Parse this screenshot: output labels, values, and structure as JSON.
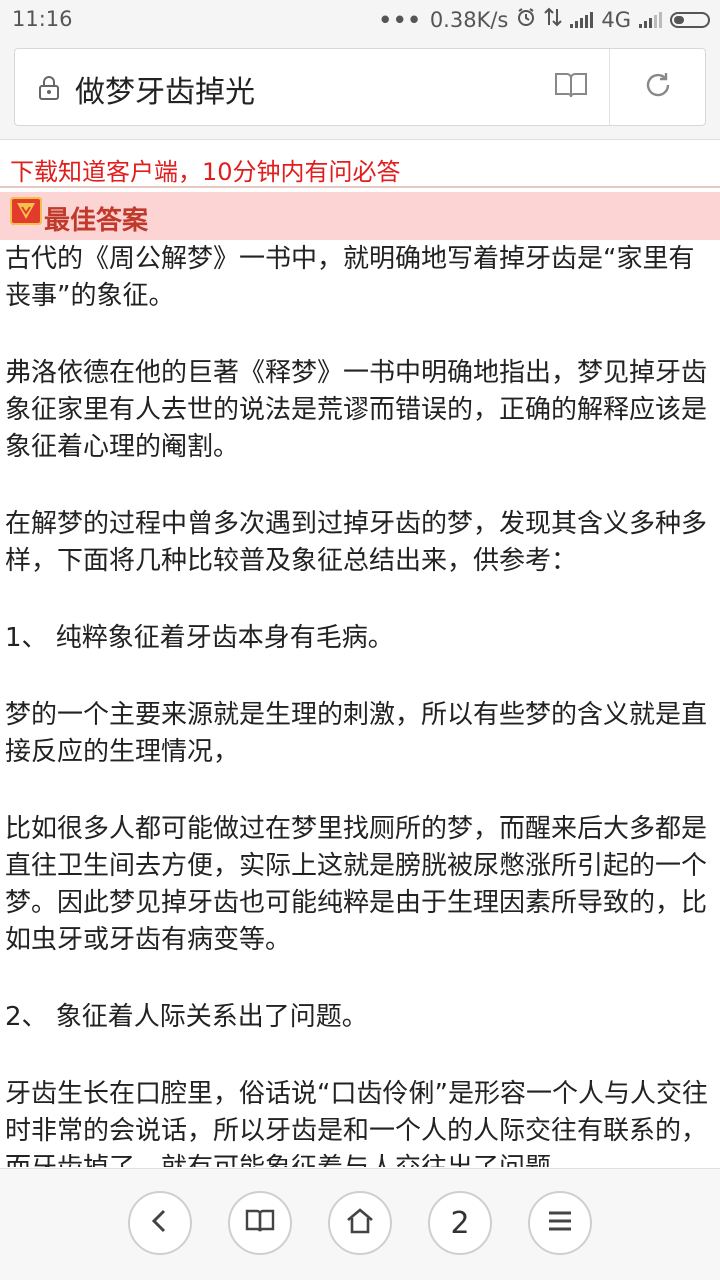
{
  "status_bar": {
    "time": "11:16",
    "network_speed": "0.38K/s",
    "network_type": "4G",
    "icons": [
      "more-dots-icon",
      "alarm-icon",
      "data-transfer-icon",
      "signal-icon",
      "signal-icon",
      "battery-icon"
    ]
  },
  "address_bar": {
    "url_text": "做梦牙齿掉光",
    "icons": [
      "lock-icon",
      "reader-book-icon",
      "reload-icon"
    ]
  },
  "promo": {
    "text": "下载知道客户端，10分钟内有问必答",
    "color": "#e11d1d"
  },
  "best_answer": {
    "label": "最佳答案",
    "icon": "best-answer-badge-icon",
    "background": "#fcd4d4"
  },
  "content": {
    "paragraphs": [
      "古代的《周公解梦》一书中，就明确地写着掉牙齿是“家里有丧事”的象征。",
      "弗洛依德在他的巨著《释梦》一书中明确地指出，梦见掉牙齿象征家里有人去世的说法是荒谬而错误的，正确的解释应该是象征着心理的阉割。",
      "在解梦的过程中曾多次遇到过掉牙齿的梦，发现其含义多种多样，下面将几种比较普及象征总结出来，供参考：",
      "1、 纯粹象征着牙齿本身有毛病。",
      "梦的一个主要来源就是生理的刺激，所以有些梦的含义就是直接反应的生理情况，",
      "比如很多人都可能做过在梦里找厕所的梦，而醒来后大多都是直往卫生间去方便，实际上这就是膀胱被尿憋涨所引起的一个梦。因此梦见掉牙齿也可能纯粹是由于生理因素所导致的，比如虫牙或牙齿有病变等。",
      "2、 象征着人际关系出了问题。",
      "牙齿生长在口腔里，俗话说“口齿伶俐”是形容一个人与人交往时非常的会说话，所以牙齿是和一个人的人际交往有联系的，而牙齿掉了，就有可能象征着与人交往出了问题。"
    ]
  },
  "bottom_nav": {
    "tabs_count": "2",
    "icons": [
      "back-icon",
      "bookmarks-icon",
      "home-icon",
      "tabs-count",
      "menu-icon"
    ]
  }
}
